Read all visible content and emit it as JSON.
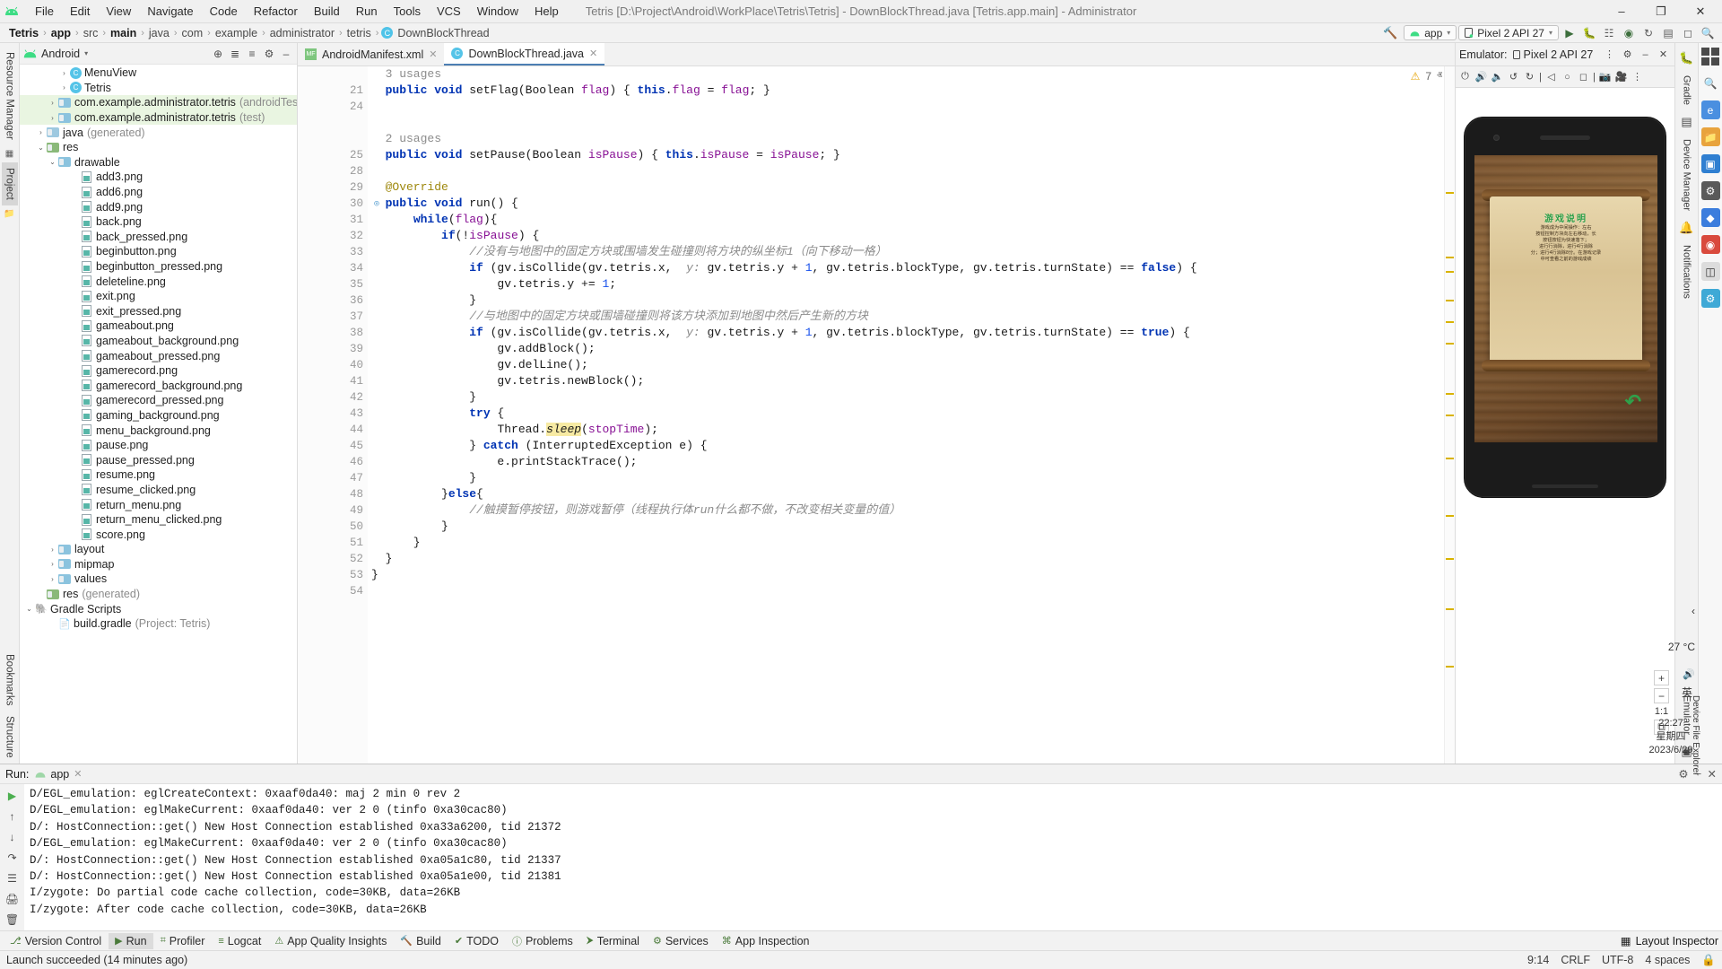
{
  "window": {
    "title": "Tetris [D:\\Project\\Android\\WorkPlace\\Tetris\\Tetris] - DownBlockThread.java [Tetris.app.main] - Administrator",
    "minimize": "–",
    "maximize": "❐",
    "close": "✕"
  },
  "menu": [
    "File",
    "Edit",
    "View",
    "Navigate",
    "Code",
    "Refactor",
    "Build",
    "Run",
    "Tools",
    "VCS",
    "Window",
    "Help"
  ],
  "breadcrumb": {
    "items": [
      {
        "label": "Tetris",
        "bold": true
      },
      {
        "label": "app",
        "bold": true
      },
      {
        "label": "src",
        "bold": false
      },
      {
        "label": "main",
        "bold": true
      },
      {
        "label": "java",
        "bold": false
      },
      {
        "label": "com",
        "bold": false
      },
      {
        "label": "example",
        "bold": false
      },
      {
        "label": "administrator",
        "bold": false
      },
      {
        "label": "tetris",
        "bold": false
      }
    ],
    "file": "DownBlockThread",
    "file_icon": "C",
    "separator": "›"
  },
  "nav_right": {
    "hammer_icon": "build-hammer-icon",
    "run_config": "app",
    "device": "Pixel 2 API 27",
    "run_icon": "▶",
    "debug_icon": "debug-icon",
    "icons": [
      "run-icon",
      "debug-icon",
      "profile-icon",
      "attach-debugger-icon",
      "sync-icon",
      "avd-manager-icon",
      "sdk-manager-icon",
      "search-everywhere-icon"
    ]
  },
  "left_strip": {
    "tabs": [
      "Resource Manager",
      "Project"
    ],
    "bottom_tabs": [
      "Bookmarks",
      "Structure"
    ]
  },
  "project_panel": {
    "header": {
      "title": "Android",
      "caret": "▾"
    },
    "tree": [
      {
        "indent": 3,
        "arrow": "›",
        "icon": "class",
        "icon_label": "C",
        "label": "MenuView",
        "dim": "",
        "hl": false
      },
      {
        "indent": 3,
        "arrow": "›",
        "icon": "class",
        "icon_label": "C",
        "label": "Tetris",
        "dim": "",
        "hl": false
      },
      {
        "indent": 2,
        "arrow": "›",
        "icon": "folder-plain",
        "label": "com.example.administrator.tetris",
        "dim": "(androidTest)",
        "hl": true
      },
      {
        "indent": 2,
        "arrow": "›",
        "icon": "folder-plain",
        "label": "com.example.administrator.tetris",
        "dim": "(test)",
        "hl": true
      },
      {
        "indent": 1,
        "arrow": "›",
        "icon": "folder-gen",
        "label": "java",
        "dim": "(generated)",
        "hl": false
      },
      {
        "indent": 1,
        "arrow": "⌄",
        "icon": "folder-res",
        "label": "res",
        "dim": "",
        "hl": false
      },
      {
        "indent": 2,
        "arrow": "⌄",
        "icon": "folder-plain",
        "label": "drawable",
        "dim": "",
        "hl": false
      },
      {
        "indent": 4,
        "arrow": "",
        "icon": "png",
        "label": "add3.png",
        "dim": "",
        "hl": false
      },
      {
        "indent": 4,
        "arrow": "",
        "icon": "png",
        "label": "add6.png",
        "dim": "",
        "hl": false
      },
      {
        "indent": 4,
        "arrow": "",
        "icon": "png",
        "label": "add9.png",
        "dim": "",
        "hl": false
      },
      {
        "indent": 4,
        "arrow": "",
        "icon": "png",
        "label": "back.png",
        "dim": "",
        "hl": false
      },
      {
        "indent": 4,
        "arrow": "",
        "icon": "png",
        "label": "back_pressed.png",
        "dim": "",
        "hl": false
      },
      {
        "indent": 4,
        "arrow": "",
        "icon": "png",
        "label": "beginbutton.png",
        "dim": "",
        "hl": false
      },
      {
        "indent": 4,
        "arrow": "",
        "icon": "png",
        "label": "beginbutton_pressed.png",
        "dim": "",
        "hl": false
      },
      {
        "indent": 4,
        "arrow": "",
        "icon": "png",
        "label": "deleteline.png",
        "dim": "",
        "hl": false
      },
      {
        "indent": 4,
        "arrow": "",
        "icon": "png",
        "label": "exit.png",
        "dim": "",
        "hl": false
      },
      {
        "indent": 4,
        "arrow": "",
        "icon": "png",
        "label": "exit_pressed.png",
        "dim": "",
        "hl": false
      },
      {
        "indent": 4,
        "arrow": "",
        "icon": "png",
        "label": "gameabout.png",
        "dim": "",
        "hl": false
      },
      {
        "indent": 4,
        "arrow": "",
        "icon": "png",
        "label": "gameabout_background.png",
        "dim": "",
        "hl": false
      },
      {
        "indent": 4,
        "arrow": "",
        "icon": "png",
        "label": "gameabout_pressed.png",
        "dim": "",
        "hl": false
      },
      {
        "indent": 4,
        "arrow": "",
        "icon": "png",
        "label": "gamerecord.png",
        "dim": "",
        "hl": false
      },
      {
        "indent": 4,
        "arrow": "",
        "icon": "png",
        "label": "gamerecord_background.png",
        "dim": "",
        "hl": false
      },
      {
        "indent": 4,
        "arrow": "",
        "icon": "png",
        "label": "gamerecord_pressed.png",
        "dim": "",
        "hl": false
      },
      {
        "indent": 4,
        "arrow": "",
        "icon": "png",
        "label": "gaming_background.png",
        "dim": "",
        "hl": false
      },
      {
        "indent": 4,
        "arrow": "",
        "icon": "png",
        "label": "menu_background.png",
        "dim": "",
        "hl": false
      },
      {
        "indent": 4,
        "arrow": "",
        "icon": "png",
        "label": "pause.png",
        "dim": "",
        "hl": false
      },
      {
        "indent": 4,
        "arrow": "",
        "icon": "png",
        "label": "pause_pressed.png",
        "dim": "",
        "hl": false
      },
      {
        "indent": 4,
        "arrow": "",
        "icon": "png",
        "label": "resume.png",
        "dim": "",
        "hl": false
      },
      {
        "indent": 4,
        "arrow": "",
        "icon": "png",
        "label": "resume_clicked.png",
        "dim": "",
        "hl": false
      },
      {
        "indent": 4,
        "arrow": "",
        "icon": "png",
        "label": "return_menu.png",
        "dim": "",
        "hl": false
      },
      {
        "indent": 4,
        "arrow": "",
        "icon": "png",
        "label": "return_menu_clicked.png",
        "dim": "",
        "hl": false
      },
      {
        "indent": 4,
        "arrow": "",
        "icon": "png",
        "label": "score.png",
        "dim": "",
        "hl": false
      },
      {
        "indent": 2,
        "arrow": "›",
        "icon": "folder-plain",
        "label": "layout",
        "dim": "",
        "hl": false
      },
      {
        "indent": 2,
        "arrow": "›",
        "icon": "folder-plain",
        "label": "mipmap",
        "dim": "",
        "hl": false
      },
      {
        "indent": 2,
        "arrow": "›",
        "icon": "folder-plain",
        "label": "values",
        "dim": "",
        "hl": false
      },
      {
        "indent": 1,
        "arrow": "",
        "icon": "folder-res",
        "label": "res",
        "dim": "(generated)",
        "hl": false
      },
      {
        "indent": 0,
        "arrow": "⌄",
        "icon": "gradle",
        "label": "Gradle Scripts",
        "dim": "",
        "hl": false
      },
      {
        "indent": 2,
        "arrow": "",
        "icon": "gradle-file",
        "label": "build.gradle",
        "dim": "(Project: Tetris)",
        "hl": false
      }
    ]
  },
  "editor": {
    "tabs": [
      {
        "label": "AndroidManifest.xml",
        "icon": "MF",
        "icon_kind": "manifest",
        "active": false,
        "close": "✕"
      },
      {
        "label": "DownBlockThread.java",
        "icon": "C",
        "icon_kind": "class",
        "active": true,
        "close": "✕"
      }
    ],
    "inspection": {
      "warn_icon": "warning-triangle-icon",
      "warn_count": "7",
      "prev": "ⱏ",
      "next": "ⱟ"
    },
    "gutter_lines": [
      "",
      "21",
      "24",
      "",
      "",
      "25",
      "28",
      "29",
      "30",
      "31",
      "32",
      "33",
      "34",
      "35",
      "36",
      "37",
      "38",
      "39",
      "40",
      "41",
      "42",
      "43",
      "44",
      "45",
      "46",
      "47",
      "48",
      "49",
      "50",
      "51",
      "52",
      "53",
      "54"
    ],
    "usages": [
      {
        "line_index": 0,
        "text": "3 usages"
      },
      {
        "line_index": 4,
        "text": "2 usages"
      }
    ],
    "code_lines": [
      "  3 usages",
      "  public void setFlag(Boolean flag) { this.flag = flag; }",
      "",
      "",
      "  2 usages",
      "  public void setPause(Boolean isPause) { this.isPause = isPause; }",
      "",
      "  @Override",
      "  public void run() {",
      "      while(flag){",
      "          if(!isPause) {",
      "              //没有与地图中的固定方块或围墙发生碰撞则将方块的纵坐标1（向下移动一格）",
      "              if (gv.isCollide(gv.tetris.x,  y: gv.tetris.y + 1, gv.tetris.blockType, gv.tetris.turnState) == false) {",
      "                  gv.tetris.y += 1;",
      "              }",
      "              //与地图中的固定方块或围墙碰撞则将该方块添加到地图中然后产生新的方块",
      "              if (gv.isCollide(gv.tetris.x,  y: gv.tetris.y + 1, gv.tetris.blockType, gv.tetris.turnState) == true) {",
      "                  gv.addBlock();",
      "                  gv.delLine();",
      "                  gv.tetris.newBlock();",
      "              }",
      "              try {",
      "                  Thread.sleep(stopTime);",
      "              } catch (InterruptedException e) {",
      "                  e.printStackTrace();",
      "              }",
      "          }else{",
      "              //触摸暂停按钮，则游戏暂停（线程执行体run什么都不做，不改变相关变量的值）",
      "          }",
      "      }",
      "  }",
      "}",
      ""
    ]
  },
  "emulator": {
    "header": {
      "label": "Emulator:",
      "device": "Pixel 2 API 27",
      "device_icon": "phone-icon",
      "menu_icon": "kebab-menu-icon",
      "settings_icon": "gear-icon",
      "minimize_icon": "–",
      "close_icon": "✕"
    },
    "toolbar_icons": [
      "power-icon",
      "volume-up-icon",
      "volume-down-icon",
      "rotate-left-icon",
      "rotate-right-icon",
      "back-icon",
      "home-icon",
      "overview-icon",
      "screenshot-icon",
      "record-icon",
      "more-icon"
    ],
    "screen": {
      "game_title": "游戏说明",
      "game_body": "游戏成为中间操作：左右\n按钮控制方块向左右移动，长\n按钮按钮为快速落下；\n进行行消除，进行4行消除\n分；进行4行消除8分。在游戏记录\n中可查看之前的游戏成绩",
      "back_arrow": "↶",
      "nav_back": "◀",
      "nav_home": "●",
      "nav_recent": "■"
    },
    "zoom": {
      "plus": "+",
      "minus": "−",
      "ratio": "1:1",
      "fit": "⧉"
    }
  },
  "right_strip": {
    "icons": [
      "gradle-icon",
      "device-manager-icon",
      "notifications-icon",
      "emulator-icon"
    ],
    "tabs": [
      "Gradle",
      "Device Manager",
      "Notifications",
      "Emulator"
    ],
    "device_file_explorer": "Device File Explorer",
    "clock": {
      "time": "22:27",
      "weekday": "星期四",
      "date": "2023/6/29"
    },
    "temp": "27 °C",
    "ime": "英"
  },
  "run_panel": {
    "header": {
      "label": "Run:",
      "tab": "app",
      "tab_icon": "android-icon",
      "close": "✕",
      "gear": "gear-icon",
      "minimize": "–"
    },
    "tool_icons": [
      "rerun-icon",
      "scroll-up-icon",
      "scroll-down-icon",
      "soft-wrap-icon",
      "print-icon",
      "clear-all-icon"
    ],
    "console_lines": [
      "D/EGL_emulation: eglCreateContext: 0xaaf0da40: maj 2 min 0 rev 2",
      "D/EGL_emulation: eglMakeCurrent: 0xaaf0da40: ver 2 0 (tinfo 0xa30cac80)",
      "D/: HostConnection::get() New Host Connection established 0xa33a6200, tid 21372",
      "D/EGL_emulation: eglMakeCurrent: 0xaaf0da40: ver 2 0 (tinfo 0xa30cac80)",
      "D/: HostConnection::get() New Host Connection established 0xa05a1c80, tid 21337",
      "D/: HostConnection::get() New Host Connection established 0xa05a1e00, tid 21381",
      "I/zygote: Do partial code cache collection, code=30KB, data=26KB",
      "I/zygote: After code cache collection, code=30KB, data=26KB"
    ]
  },
  "tool_tabs": {
    "items": [
      {
        "label": "Version Control",
        "icon": "branch-icon",
        "sel": false
      },
      {
        "label": "Run",
        "icon": "run-icon",
        "sel": true
      },
      {
        "label": "Profiler",
        "icon": "profiler-icon",
        "sel": false
      },
      {
        "label": "Logcat",
        "icon": "logcat-icon",
        "sel": false
      },
      {
        "label": "App Quality Insights",
        "icon": "insights-icon",
        "sel": false
      },
      {
        "label": "Build",
        "icon": "build-icon",
        "sel": false
      },
      {
        "label": "TODO",
        "icon": "todo-icon",
        "sel": false
      },
      {
        "label": "Problems",
        "icon": "problems-icon",
        "sel": false
      },
      {
        "label": "Terminal",
        "icon": "terminal-icon",
        "sel": false
      },
      {
        "label": "Services",
        "icon": "services-icon",
        "sel": false
      },
      {
        "label": "App Inspection",
        "icon": "inspection-icon",
        "sel": false
      }
    ],
    "right": {
      "label": "Layout Inspector",
      "icon": "layout-inspector-icon"
    }
  },
  "status_bar": {
    "message": "Launch succeeded (14 minutes ago)",
    "right": {
      "caret": "9:14",
      "line_sep": "CRLF",
      "encoding": "UTF-8",
      "indent": "4 spaces",
      "lock_icon": "lock-icon"
    }
  },
  "colors": {
    "accent": "#4d7fb3",
    "green": "#3ddc84",
    "warn": "#e5a50a",
    "highlight_row": "#e9f5e1",
    "keyword": "#0033b3",
    "field": "#871094",
    "comment": "#8c8c8c"
  }
}
